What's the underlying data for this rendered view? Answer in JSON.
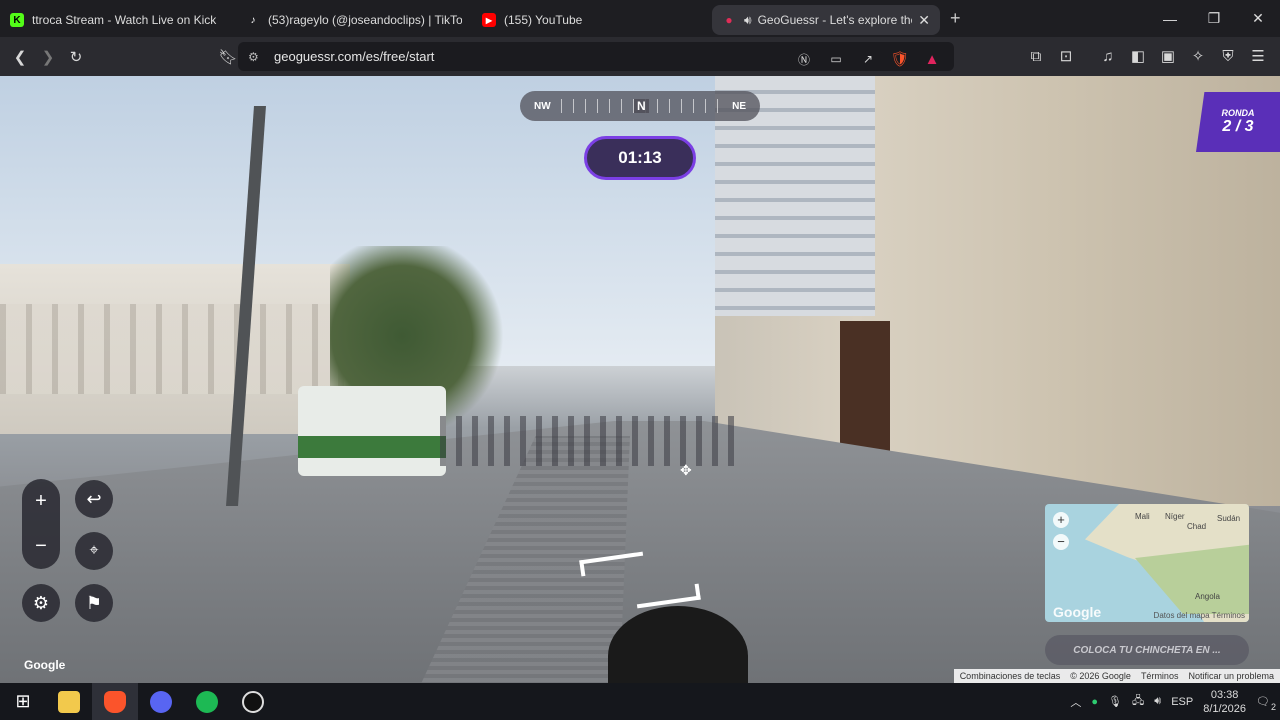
{
  "tabs": [
    {
      "title": "ttroca Stream - Watch Live on Kick",
      "favicon_color": "#53fc18",
      "favicon_glyph": "K"
    },
    {
      "title": "(53)rageylo (@joseandoclips) | TikTok",
      "favicon_color": "#ffffff",
      "favicon_glyph": "♪"
    },
    {
      "title": "(155) YouTube",
      "favicon_color": "#ff0000",
      "favicon_glyph": "▶"
    },
    {
      "title": "GeoGuessr - Let's explore the",
      "favicon_color": "#e02d57",
      "favicon_glyph": "●",
      "active": true
    }
  ],
  "url": "geoguessr.com/es/free/start",
  "game": {
    "compass_left": "NW",
    "compass_center": "N",
    "compass_right": "NE",
    "timer": "01:13",
    "round_label": "RONDA",
    "round_value": "2 / 3",
    "guess_button": "COLOCA TU CHINCHETA EN ..."
  },
  "minimap": {
    "places": [
      "Mali",
      "Níger",
      "Chad",
      "Sudán",
      "Angola"
    ],
    "footer_text": "Datos del mapa  Términos",
    "logo": "Google"
  },
  "streetview_logo": "Google",
  "attribution": [
    "Combinaciones de teclas",
    "© 2026 Google",
    "Términos",
    "Notificar un problema"
  ],
  "taskbar": {
    "language": "ESP",
    "time": "03:38",
    "date": "8/1/2026",
    "notification_count": "2"
  },
  "colors": {
    "accent": "#7b3fe4",
    "round_bg": "#5a2fb8"
  }
}
